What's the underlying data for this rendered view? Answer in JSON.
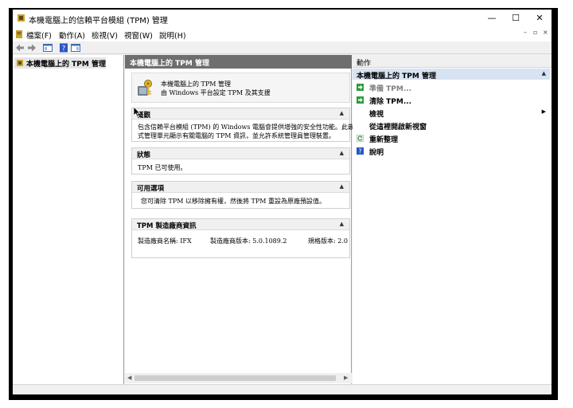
{
  "window": {
    "title": "本機電腦上的信賴平台模組 (TPM) 管理",
    "controls": {
      "minimize": "—",
      "maximize": "☐",
      "close": "✕"
    },
    "mdi_controls": {
      "minimize": "–",
      "restore": "▫",
      "close": "×"
    }
  },
  "menu": {
    "items": [
      "檔案(F)",
      "動作(A)",
      "檢視(V)",
      "視窗(W)",
      "說明(H)"
    ]
  },
  "tree": {
    "root_label": "本機電腦上的 TPM 管理"
  },
  "center": {
    "header": "本機電腦上的 TPM 管理",
    "intro": {
      "line1": "本機電腦上的 TPM 管理",
      "line2": "由 Windows 平台設定 TPM 及其支援"
    },
    "sections": [
      {
        "title": "概觀",
        "lines": [
          "包含信賴平台模組 (TPM) 的 Windows 電腦會提供增強的安全性功能。此嵌入",
          "式管理單元顯示有關電腦的 TPM 資訊，並允許系統管理員管理裝置。"
        ]
      },
      {
        "title": "狀態",
        "lines": [
          "TPM 已可使用。"
        ]
      },
      {
        "title": "可用選項",
        "lines": [
          "您可清除 TPM 以移除擁有權，然後將 TPM 重設為原廠預設值。"
        ]
      },
      {
        "title": "TPM 製造廠商資訊",
        "fields": [
          "製造廠商名稱: IFX",
          "製造廠商版本: 5.0.1089.2",
          "規格版本: 2.0"
        ]
      }
    ]
  },
  "actions": {
    "title": "動作",
    "group": "本機電腦上的 TPM 管理",
    "items": [
      {
        "label": "準備 TPM...",
        "icon": "green-arrow-icon",
        "enabled": false
      },
      {
        "label": "清除 TPM...",
        "icon": "green-arrow-icon",
        "enabled": true
      },
      {
        "label": "檢視",
        "icon": "",
        "enabled": true,
        "submenu": true
      },
      {
        "label": "從這裡開啟新視窗",
        "icon": "",
        "enabled": true
      },
      {
        "label": "重新整理",
        "icon": "refresh-icon",
        "enabled": true
      },
      {
        "label": "說明",
        "icon": "help-icon",
        "enabled": true
      }
    ]
  },
  "colors": {
    "center_header_bg": "#6e6e6e",
    "action_group_bg": "#d7e3f2",
    "action_icon_green": "#2e9b3c",
    "help_icon_blue": "#2a56c6"
  }
}
